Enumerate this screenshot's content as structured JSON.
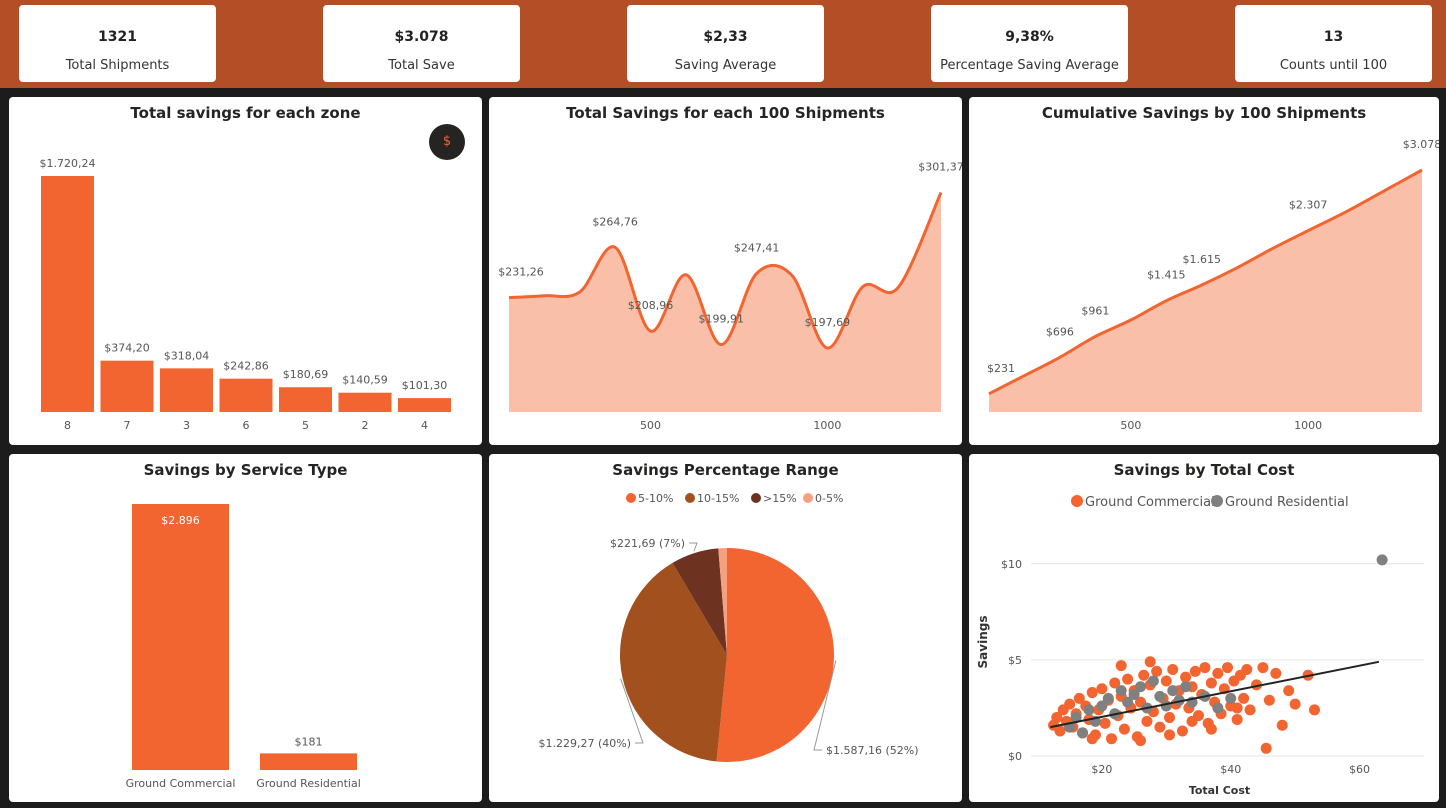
{
  "kpis": [
    {
      "value": "1321",
      "label": "Total Shipments"
    },
    {
      "value": "$3.078",
      "label": "Total Save"
    },
    {
      "value": "$2,33",
      "label": "Saving Average"
    },
    {
      "value": "9,38%",
      "label": "Percentage Saving Average"
    },
    {
      "value": "13",
      "label": "Counts until 100"
    }
  ],
  "colors": {
    "accent": "#f26430",
    "area_fill": "#f9bfa8",
    "header_bg": "#b34e27",
    "background": "#1c1c1c",
    "residential": "#808080",
    "range_10_15": "#a3501f",
    "range_gt_15": "#6e3320",
    "range_0_5": "#f5a07e"
  },
  "zone_button": {
    "icon": "dollar-icon",
    "symbol": "$"
  },
  "chart_data": [
    {
      "id": "zone",
      "type": "bar",
      "title": "Total savings for each zone",
      "categories": [
        "8",
        "7",
        "3",
        "6",
        "5",
        "2",
        "4"
      ],
      "values": [
        1720.24,
        374.2,
        318.04,
        242.86,
        180.69,
        140.59,
        101.3
      ],
      "data_labels": [
        "$1.720,24",
        "$374,20",
        "$318,04",
        "$242,86",
        "$180,69",
        "$140,59",
        "$101,30"
      ],
      "ylim": [
        0,
        1720.24
      ]
    },
    {
      "id": "per100",
      "type": "area",
      "title": "Total Savings for each 100 Shipments",
      "x": [
        100,
        200,
        300,
        400,
        500,
        600,
        700,
        800,
        900,
        1000,
        1100,
        1200,
        1321
      ],
      "values": [
        231.26,
        232.5,
        235.0,
        264.76,
        208.96,
        246.5,
        199.91,
        247.41,
        246.0,
        197.69,
        238.5,
        238.0,
        301.37
      ],
      "data_labels": [
        {
          "index": 0,
          "text": "$231,26"
        },
        {
          "index": 3,
          "text": "$264,76"
        },
        {
          "index": 4,
          "text": "$208,96"
        },
        {
          "index": 6,
          "text": "$199,91"
        },
        {
          "index": 7,
          "text": "$247,41"
        },
        {
          "index": 9,
          "text": "$197,69"
        },
        {
          "index": 12,
          "text": "$301,37"
        }
      ],
      "xticks": [
        500,
        1000
      ],
      "ylim": [
        155,
        315
      ]
    },
    {
      "id": "cumulative",
      "type": "area",
      "title": "Cumulative Savings by 100 Shipments",
      "x": [
        100,
        200,
        300,
        400,
        500,
        600,
        700,
        800,
        900,
        1000,
        1100,
        1200,
        1321
      ],
      "values": [
        231,
        463,
        696,
        961,
        1170,
        1415,
        1615,
        1835,
        2080,
        2307,
        2530,
        2777,
        3078
      ],
      "data_labels": [
        {
          "index": 0,
          "text": "$231"
        },
        {
          "index": 2,
          "text": "$696"
        },
        {
          "index": 3,
          "text": "$961"
        },
        {
          "index": 5,
          "text": "$1.415"
        },
        {
          "index": 6,
          "text": "$1.615"
        },
        {
          "index": 9,
          "text": "$2.307"
        },
        {
          "index": 12,
          "text": "$3.078"
        }
      ],
      "xticks": [
        500,
        1000
      ],
      "ylim": [
        0,
        3078
      ]
    },
    {
      "id": "service",
      "type": "bar",
      "title": "Savings by Service Type",
      "categories": [
        "Ground Commercial",
        "Ground Residential"
      ],
      "values": [
        2896,
        181
      ],
      "data_labels": [
        "$2.896",
        "$181"
      ],
      "ylim": [
        0,
        2896
      ]
    },
    {
      "id": "range",
      "type": "pie",
      "title": "Savings Percentage Range",
      "legend": [
        "5-10%",
        "10-15%",
        ">15%",
        "0-5%"
      ],
      "slices": [
        {
          "name": "5-10%",
          "value": 1587.16,
          "label": "$1.587,16 (52%)"
        },
        {
          "name": "10-15%",
          "value": 1229.27,
          "label": "$1.229,27 (40%)"
        },
        {
          "name": ">15%",
          "value": 221.69,
          "label": "$221,69 (7%)"
        },
        {
          "name": "0-5%",
          "value": 40.0,
          "label": ""
        }
      ],
      "legend_position": "top"
    },
    {
      "id": "scatter",
      "type": "scatter",
      "title": "Savings by Total Cost",
      "xlabel": "Total Cost",
      "ylabel": "Savings",
      "legend": [
        "Ground Commercial",
        "Ground Residential"
      ],
      "xticks": [
        20,
        40,
        60
      ],
      "xtick_labels": [
        "$20",
        "$40",
        "$60"
      ],
      "yticks": [
        0,
        5,
        10
      ],
      "ytick_labels": [
        "$0",
        "$5",
        "$10"
      ],
      "xlim": [
        9,
        70
      ],
      "ylim": [
        0,
        10
      ],
      "trendline": [
        [
          12,
          1.5
        ],
        [
          63,
          4.9
        ]
      ],
      "series": [
        {
          "name": "Ground Commercial",
          "points": [
            [
              12.5,
              1.6
            ],
            [
              13,
              2.0
            ],
            [
              13.5,
              1.3
            ],
            [
              14,
              2.4
            ],
            [
              14.5,
              1.8
            ],
            [
              15,
              2.7
            ],
            [
              15.5,
              1.5
            ],
            [
              16,
              2.2
            ],
            [
              16.5,
              3.0
            ],
            [
              17,
              1.2
            ],
            [
              17.5,
              2.6
            ],
            [
              18,
              1.9
            ],
            [
              18.5,
              3.3
            ],
            [
              19,
              1.1
            ],
            [
              19.5,
              2.4
            ],
            [
              20,
              3.5
            ],
            [
              20.5,
              1.7
            ],
            [
              21,
              2.9
            ],
            [
              21.5,
              0.9
            ],
            [
              22,
              3.8
            ],
            [
              22.5,
              2.1
            ],
            [
              23,
              3.1
            ],
            [
              23.5,
              1.4
            ],
            [
              24,
              4.0
            ],
            [
              24.5,
              2.5
            ],
            [
              25,
              3.4
            ],
            [
              25.5,
              1.0
            ],
            [
              26,
              2.8
            ],
            [
              26.5,
              4.2
            ],
            [
              27,
              1.8
            ],
            [
              27.5,
              3.7
            ],
            [
              28,
              2.3
            ],
            [
              28.5,
              4.4
            ],
            [
              29,
              1.5
            ],
            [
              29.5,
              3.0
            ],
            [
              30,
              3.9
            ],
            [
              30.5,
              2.0
            ],
            [
              31,
              4.5
            ],
            [
              31.5,
              2.7
            ],
            [
              32,
              3.4
            ],
            [
              32.5,
              1.3
            ],
            [
              33,
              4.1
            ],
            [
              33.5,
              2.5
            ],
            [
              34,
              3.6
            ],
            [
              34.5,
              4.4
            ],
            [
              35,
              2.1
            ],
            [
              35.5,
              3.2
            ],
            [
              36,
              4.6
            ],
            [
              36.5,
              1.7
            ],
            [
              37,
              3.8
            ],
            [
              37.5,
              2.8
            ],
            [
              38,
              4.3
            ],
            [
              38.5,
              2.2
            ],
            [
              39,
              3.5
            ],
            [
              39.5,
              4.6
            ],
            [
              40,
              2.6
            ],
            [
              40.5,
              3.9
            ],
            [
              41,
              1.9
            ],
            [
              41.5,
              4.2
            ],
            [
              42,
              3.0
            ],
            [
              42.5,
              4.5
            ],
            [
              43,
              2.4
            ],
            [
              44,
              3.7
            ],
            [
              45,
              4.6
            ],
            [
              46,
              2.9
            ],
            [
              47,
              4.3
            ],
            [
              48,
              1.6
            ],
            [
              49,
              3.4
            ],
            [
              50,
              2.7
            ],
            [
              52,
              4.2
            ],
            [
              53,
              2.4
            ],
            [
              45.5,
              0.4
            ],
            [
              27.5,
              4.9
            ],
            [
              23,
              4.7
            ],
            [
              30.5,
              1.1
            ],
            [
              26,
              0.8
            ],
            [
              34,
              1.8
            ],
            [
              18.5,
              0.9
            ],
            [
              37,
              1.4
            ],
            [
              41,
              2.5
            ]
          ]
        },
        {
          "name": "Ground Residential",
          "points": [
            [
              15,
              1.5
            ],
            [
              16,
              2.0
            ],
            [
              17,
              1.2
            ],
            [
              18,
              2.4
            ],
            [
              19,
              1.8
            ],
            [
              20,
              2.6
            ],
            [
              21,
              3.0
            ],
            [
              22,
              2.2
            ],
            [
              23,
              3.4
            ],
            [
              24,
              2.8
            ],
            [
              25,
              3.2
            ],
            [
              26,
              3.6
            ],
            [
              27,
              2.5
            ],
            [
              28,
              3.9
            ],
            [
              29,
              3.1
            ],
            [
              30,
              2.6
            ],
            [
              31,
              3.4
            ],
            [
              32,
              2.9
            ],
            [
              33,
              3.6
            ],
            [
              34,
              2.8
            ],
            [
              36,
              3.1
            ],
            [
              38,
              2.5
            ],
            [
              40,
              3.0
            ],
            [
              63.5,
              10.2
            ]
          ]
        }
      ]
    }
  ]
}
